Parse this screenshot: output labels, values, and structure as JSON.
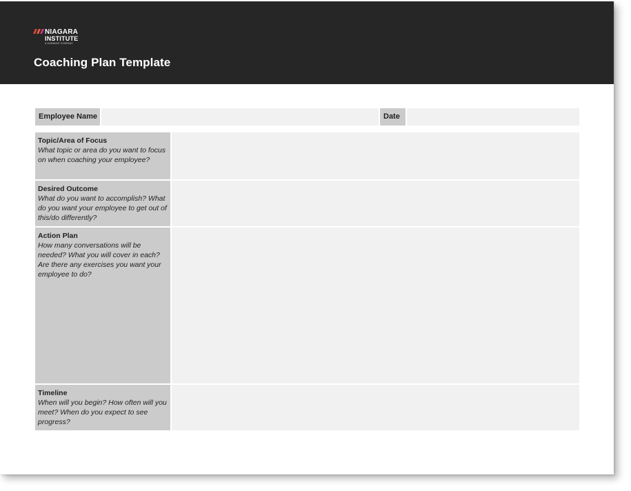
{
  "brand": {
    "line1": "NIAGARA",
    "line2": "INSTITUTE",
    "tagline": "A HUMANCE COMPANY",
    "stripe_colors": [
      "#e5433a",
      "#e8622f",
      "#c33a8c"
    ]
  },
  "document": {
    "title": "Coaching Plan Template"
  },
  "form": {
    "employee_name_label": "Employee Name",
    "employee_name_value": "",
    "date_label": "Date",
    "date_value": "",
    "sections": [
      {
        "heading": "Topic/Area of Focus",
        "prompt": "What topic or area do you want to focus on when coaching your employee?",
        "value": ""
      },
      {
        "heading": "Desired Outcome",
        "prompt": "What do you want to accomplish? What do you want your employee to get out of this/do differently?",
        "value": ""
      },
      {
        "heading": "Action Plan",
        "prompt": "How many conversations will be needed? What you will cover in each? Are there any exercises you want your employee to do?",
        "value": ""
      },
      {
        "heading": "Timeline",
        "prompt": "When will you begin? How often will you meet? When do you expect to see progress?",
        "value": ""
      }
    ]
  },
  "colors": {
    "header_bg": "#262626",
    "label_bg": "#cbcbcb",
    "field_bg": "#f1f1f1"
  }
}
